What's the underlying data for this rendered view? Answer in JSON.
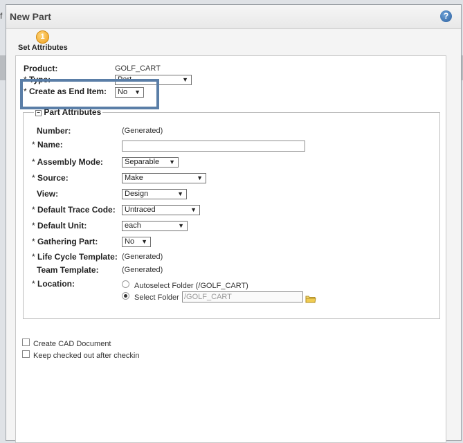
{
  "background": {
    "edge_left": "f",
    "edge_right": "D."
  },
  "dialog": {
    "title": "New Part",
    "help_icon": "question-icon",
    "step_number": "1",
    "step_label": "Set Attributes"
  },
  "form": {
    "product_label": "Product:",
    "product_value": "GOLF_CART",
    "type_label": "Type:",
    "type_value": "Part",
    "end_item_label": "Create as End Item:",
    "end_item_value": "No",
    "section_label": "Part Attributes",
    "fields": {
      "number_label": "Number:",
      "number_value": "(Generated)",
      "name_label": "Name:",
      "name_value": "",
      "assembly_label": "Assembly Mode:",
      "assembly_value": "Separable",
      "source_label": "Source:",
      "source_value": "Make",
      "view_label": "View:",
      "view_value": "Design",
      "trace_label": "Default Trace Code:",
      "trace_value": "Untraced",
      "unit_label": "Default Unit:",
      "unit_value": "each",
      "gathering_label": "Gathering Part:",
      "gathering_value": "No",
      "lifecycle_label": "Life Cycle Template:",
      "lifecycle_value": "(Generated)",
      "team_label": "Team Template:",
      "team_value": "(Generated)",
      "location_label": "Location:",
      "autoselect_label": "Autoselect Folder (/GOLF_CART)",
      "select_folder_label": "Select Folder",
      "folder_path": "/GOLF_CART",
      "selected_location": "select-folder"
    },
    "create_cad_label": "Create CAD Document",
    "keep_checked_out_label": "Keep checked out after checkin",
    "required_mark": "*"
  },
  "colors": {
    "highlight_border": "#5a7ea7",
    "help_icon": "#2b5f9e",
    "step_icon": "#f0a020"
  }
}
